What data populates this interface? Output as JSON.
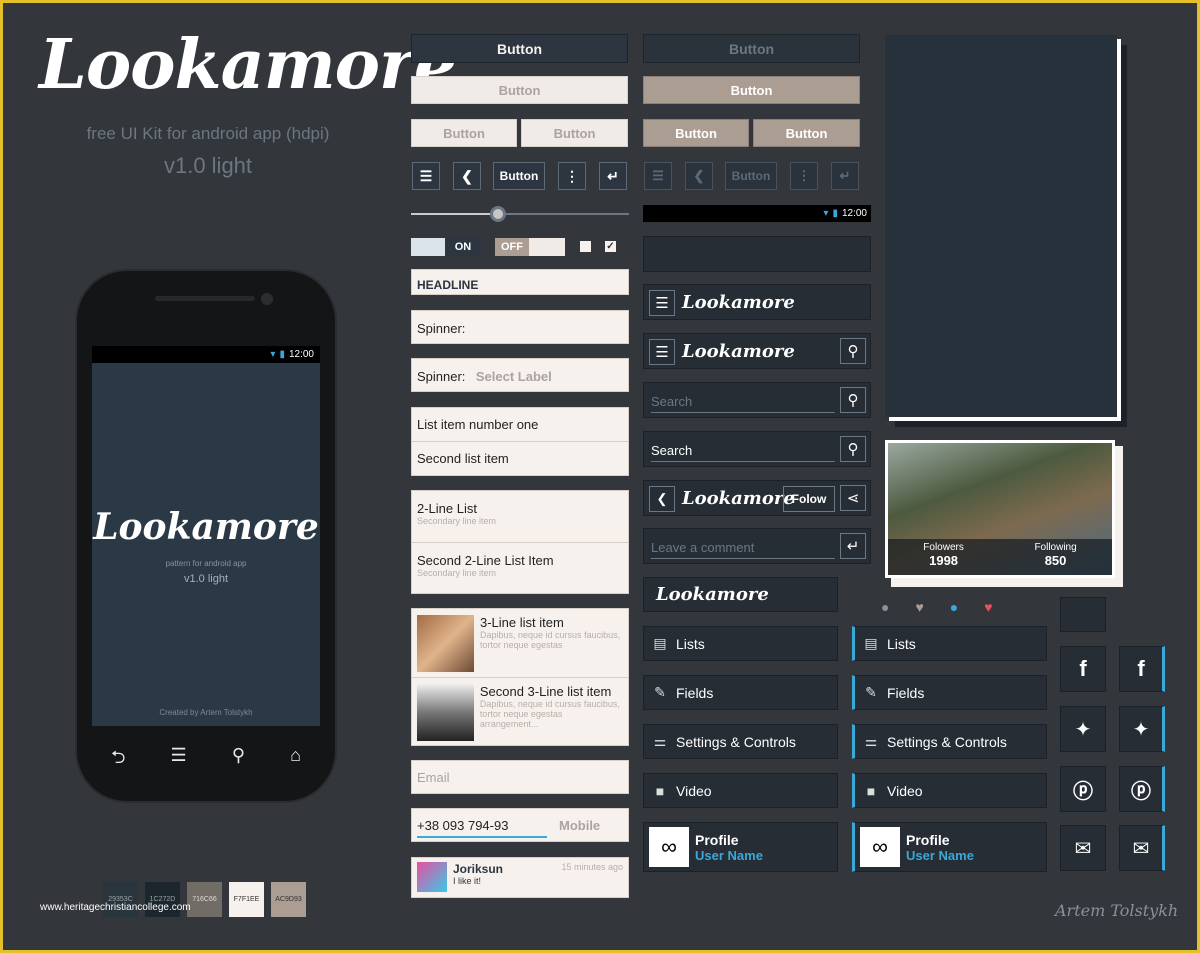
{
  "title": {
    "logo": "Lookamore",
    "subtitle": "free UI Kit for android app (hdpi)",
    "version": "v1.0 light"
  },
  "phone": {
    "status_time": "12:00",
    "logo": "Lookamore",
    "tagline": "pattern for android app",
    "version": "v1.0 light",
    "credit": "Created by Artem Tolstykh"
  },
  "watermark": "www.heritagechristiancollege.com",
  "swatches": [
    {
      "hex": "#29353C",
      "label": "29353C"
    },
    {
      "hex": "#1C272D",
      "label": "1C272D"
    },
    {
      "hex": "#716C66",
      "label": "716C66"
    },
    {
      "hex": "#F7F1EE",
      "label": "F7F1EE"
    },
    {
      "hex": "#AC9D93",
      "label": "AC9D93"
    }
  ],
  "col1": {
    "button": "Button",
    "toggle_on": "ON",
    "toggle_off": "OFF",
    "slider_value": 0.4,
    "headline": "HEADLINE",
    "spinner1_label": "Spinner:",
    "spinner2_label": "Spinner:",
    "spinner2_value": "Select Label",
    "list1": [
      "List item number one",
      "Second list item"
    ],
    "list2": [
      {
        "title": "2-Line List",
        "sub": "Secondary line item"
      },
      {
        "title": "Second 2-Line List Item",
        "sub": "Secondary line item"
      }
    ],
    "list3": [
      {
        "title": "3-Line list item",
        "sub1": "Dapibus, neque id cursus faucibus,",
        "sub2": "tortor neque egestas"
      },
      {
        "title": "Second 3-Line list item",
        "sub1": "Dapibus, neque id cursus faucibus,",
        "sub2": "tortor neque egestas arrangement..."
      }
    ],
    "email_placeholder": "Email",
    "phone_value": "+38 093 794-93",
    "mobile_placeholder": "Mobile",
    "comment": {
      "user": "Joriksun",
      "time": "15 minutes ago",
      "text": "I like it!"
    }
  },
  "col2": {
    "button": "Button",
    "status_time": "12:00",
    "logo": "Lookamore",
    "search_placeholder": "Search",
    "search_value": "Search",
    "follow": "Folow",
    "comment_placeholder": "Leave a comment"
  },
  "menu": {
    "items": [
      {
        "label": "Lists",
        "icon": "list-icon"
      },
      {
        "label": "Fields",
        "icon": "pencil-icon"
      },
      {
        "label": "Settings & Controls",
        "icon": "sliders-icon"
      },
      {
        "label": "Video",
        "icon": "video-icon"
      }
    ],
    "profile": {
      "name": "Profile",
      "user": "User Name"
    }
  },
  "profile_card": {
    "followers_label": "Folowers",
    "followers": "1998",
    "following_label": "Following",
    "following": "850"
  },
  "social": [
    "facebook-icon",
    "twitter-icon",
    "pinterest-icon",
    "mail-icon"
  ],
  "signature": "Artem Tolstykh",
  "colors": {
    "accent": "#3aa8d8",
    "heart_red": "#e8505b",
    "heart_tan": "#ac9d93"
  }
}
